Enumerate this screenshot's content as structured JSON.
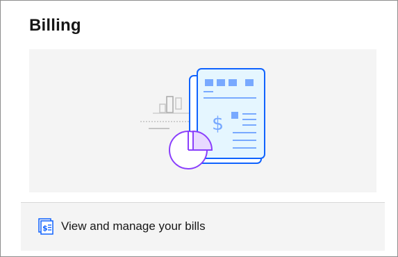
{
  "card": {
    "title": "Billing",
    "illustration_icon": "billing-document-icon",
    "action": {
      "label": "View and manage your bills",
      "icon": "bill-icon"
    }
  },
  "colors": {
    "accent_blue": "#0f62fe",
    "light_blue": "#bae6ff",
    "mid_blue": "#78a9ff",
    "purple": "#8a3ffc",
    "panel_gray": "#f4f4f4",
    "text": "#161616"
  }
}
